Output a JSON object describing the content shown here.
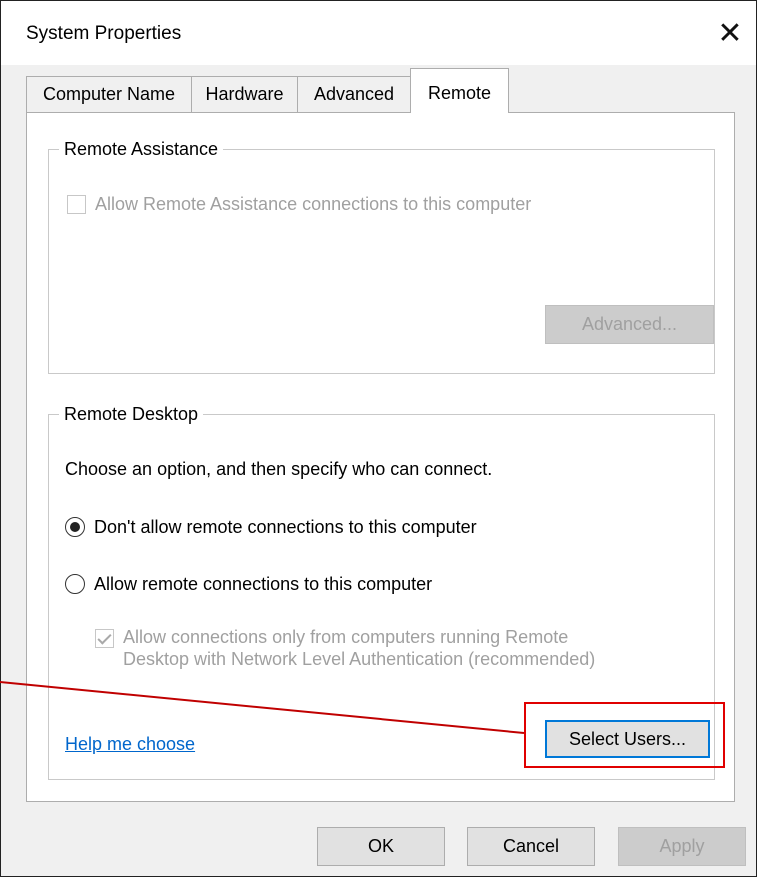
{
  "window": {
    "title": "System Properties",
    "close_glyph": "✕"
  },
  "tabs": [
    {
      "label": "Computer Name",
      "active": false
    },
    {
      "label": "Hardware",
      "active": false
    },
    {
      "label": "Advanced",
      "active": false
    },
    {
      "label": "Remote",
      "active": true
    }
  ],
  "remote_assistance": {
    "group_label": "Remote Assistance",
    "checkbox_label": "Allow Remote Assistance connections to this computer",
    "checkbox_checked": false,
    "enabled": false,
    "advanced_button": "Advanced..."
  },
  "remote_desktop": {
    "group_label": "Remote Desktop",
    "instruction": "Choose an option, and then specify who can connect.",
    "options": [
      {
        "label": "Don't allow remote connections to this computer",
        "selected": true
      },
      {
        "label": "Allow remote connections to this computer",
        "selected": false
      }
    ],
    "nla_line1": "Allow connections only from computers running Remote",
    "nla_line2": "Desktop with Network Level Authentication (recommended)",
    "nla_checked": true,
    "help_link": "Help me choose",
    "select_users_button": "Select Users..."
  },
  "footer": {
    "ok": "OK",
    "cancel": "Cancel",
    "apply": "Apply"
  },
  "annotation": {
    "highlight_color": "#e00000",
    "target": "select-users-button"
  }
}
